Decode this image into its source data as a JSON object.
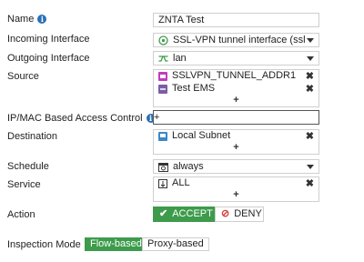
{
  "labels": {
    "name": "Name",
    "incoming": "Incoming Interface",
    "outgoing": "Outgoing Interface",
    "source": "Source",
    "ipmac": "IP/MAC Based Access Control",
    "destination": "Destination",
    "schedule": "Schedule",
    "service": "Service",
    "action": "Action",
    "inspection": "Inspection Mode"
  },
  "info_glyph": "i",
  "name_value": "ZNTA Test",
  "incoming_interface": {
    "value": "SSL-VPN tunnel interface (ssl.root)",
    "icon": "ssl-vpn-icon"
  },
  "outgoing_interface": {
    "value": "lan",
    "icon": "network-interface-icon"
  },
  "source": [
    {
      "name": "SSLVPN_TUNNEL_ADDR1",
      "icon": "address-magenta-icon",
      "color": "#c03cbf"
    },
    {
      "name": "Test EMS",
      "icon": "ems-tag-icon",
      "color": "#7b5ea7"
    }
  ],
  "ipmac_items": [],
  "destination": [
    {
      "name": "Local Subnet",
      "icon": "subnet-icon",
      "color": "#3a87c8"
    }
  ],
  "schedule": {
    "value": "always",
    "icon": "schedule-icon"
  },
  "service": [
    {
      "name": "ALL",
      "icon": "service-icon"
    }
  ],
  "glyphs": {
    "remove": "✖",
    "add": "+"
  },
  "action": {
    "accept": "ACCEPT",
    "deny": "DENY",
    "accept_glyph": "✔",
    "deny_glyph": "⊘",
    "selected": "ACCEPT"
  },
  "inspection_mode": {
    "flow": "Flow-based",
    "proxy": "Proxy-based",
    "selected": "Flow-based"
  },
  "colors": {
    "accent_green": "#3d9b4b",
    "info_blue": "#2a6fb6",
    "deny_red": "#d23c3c"
  }
}
